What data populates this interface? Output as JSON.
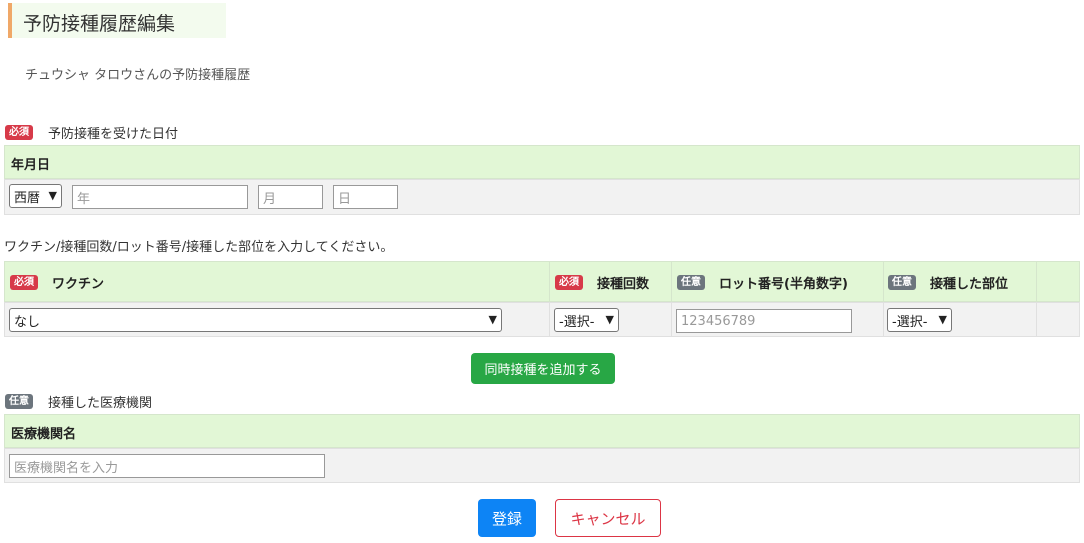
{
  "page": {
    "title": "予防接種履歴編集",
    "subtitle": "チュウシャ タロウさんの予防接種履歴"
  },
  "badges": {
    "required": "必須",
    "optional": "任意"
  },
  "date_section": {
    "label": "予防接種を受けた日付",
    "header": "年月日",
    "era_select": "西暦",
    "year_placeholder": "年",
    "month_placeholder": "月",
    "day_placeholder": "日"
  },
  "vaccine_section": {
    "instruction": "ワクチン/接種回数/ロット番号/接種した部位を入力してください。",
    "columns": {
      "vaccine": "ワクチン",
      "dose": "接種回数",
      "lot": "ロット番号(半角数字)",
      "site": "接種した部位"
    },
    "row": {
      "vaccine_value": "なし",
      "dose_value": "-選択-",
      "lot_placeholder": "123456789",
      "site_value": "-選択-"
    },
    "add_button": "同時接種を追加する"
  },
  "institution_section": {
    "label": "接種した医療機関",
    "header": "医療機関名",
    "placeholder": "医療機関名を入力"
  },
  "actions": {
    "submit": "登録",
    "cancel": "キャンセル"
  }
}
